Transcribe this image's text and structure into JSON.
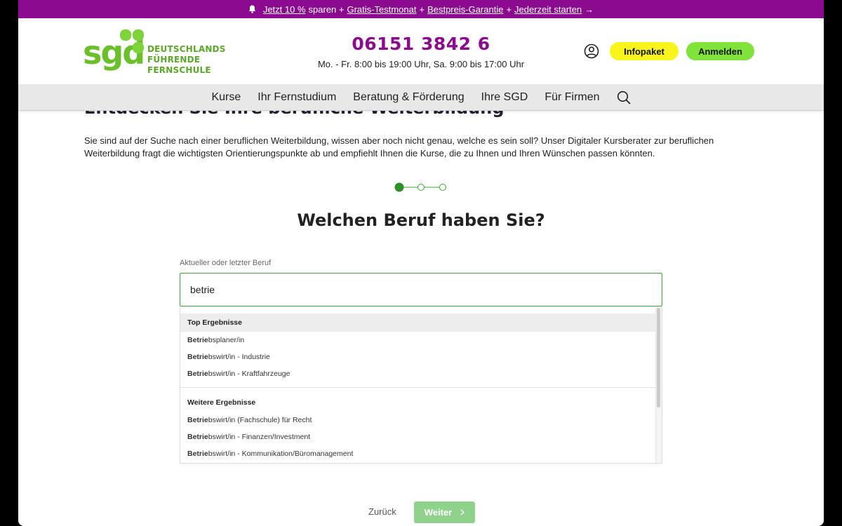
{
  "promo": {
    "segments": [
      {
        "text": "Jetzt 10 %",
        "link": true
      },
      {
        "text": "sparen +",
        "link": false
      },
      {
        "text": "Gratis-Testmonat",
        "link": true
      },
      {
        "text": "+",
        "link": false
      },
      {
        "text": "Bestpreis-Garantie",
        "link": true
      },
      {
        "text": "+",
        "link": false
      },
      {
        "text": "Jederzeit starten",
        "link": true
      },
      {
        "text": "→",
        "link": false
      }
    ],
    "bg_color": "#8b0a8f"
  },
  "header": {
    "logo_text": "sgd",
    "logo_tagline_1": "DEUTSCHLANDS",
    "logo_tagline_2": "FÜHRENDE FERNSCHULE",
    "phone": "06151 3842 6",
    "hours": "Mo. - Fr. 8:00 bis 19:00 Uhr, Sa. 9:00 bis 17:00 Uhr",
    "infopaket_label": "Infopaket",
    "login_label": "Anmelden",
    "accent": "#8b0a8f",
    "brand_green": "#6bbf2a"
  },
  "nav": {
    "items": [
      "Kurse",
      "Ihr Fernstudium",
      "Beratung & Förderung",
      "Ihre SGD",
      "Für Firmen"
    ],
    "search_icon": "search-icon"
  },
  "main": {
    "behind_title": "Entdecken Sie Ihre berufliche Weiterbildung",
    "intro": "Sie sind auf der Suche nach einer beruflichen Weiterbildung, wissen aber noch nicht genau, welche es sein soll? Unser Digitaler Kursberater zur beruflichen Weiterbildung fragt die wichtigsten Orientierungspunkte ab und empfiehlt Ihnen die Kurse, die zu Ihnen und Ihren Wünschen passen könnten.",
    "steps": {
      "total": 3,
      "current": 1
    },
    "question": "Welchen Beruf haben Sie?",
    "field_label": "Aktueller oder letzter Beruf",
    "field_value": "betrie"
  },
  "dropdown": {
    "groups": [
      {
        "heading": "Top Ergebnisse",
        "items": [
          {
            "match": "Betrie",
            "rest": "bsplaner/in"
          },
          {
            "match": "Betrie",
            "rest": "bswirt/in - Industrie"
          },
          {
            "match": "Betrie",
            "rest": "bswirt/in - Kraftfahrzeuge"
          }
        ]
      },
      {
        "heading": "Weitere Ergebnisse",
        "items": [
          {
            "match": "Betrie",
            "rest": "bswirt/in (Fachschule) für Recht"
          },
          {
            "match": "Betrie",
            "rest": "bswirt/in - Finanzen/Investment"
          },
          {
            "match": "Betrie",
            "rest": "bswirt/in - Kommunikation/Büromanagement"
          }
        ]
      }
    ]
  },
  "footer_buttons": {
    "back_label": "Zurück",
    "next_label": "Weiter",
    "next_icon": "chevron-right-icon"
  }
}
